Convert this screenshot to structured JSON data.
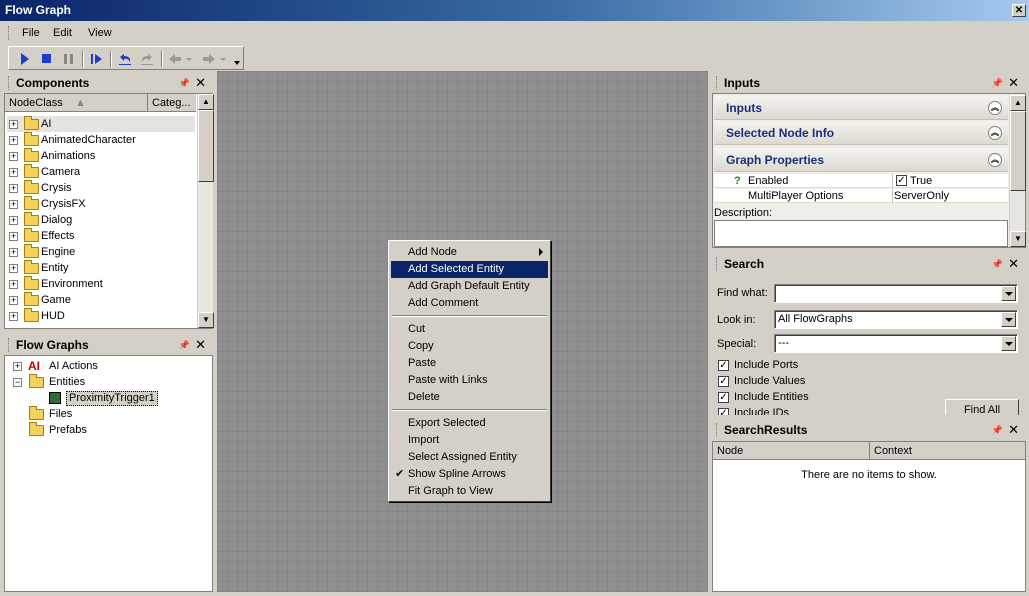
{
  "window": {
    "title": "Flow Graph",
    "close_glyph": "✕"
  },
  "menu": {
    "file": "File",
    "edit": "Edit",
    "view": "View"
  },
  "components": {
    "title": "Components",
    "pin": "📌",
    "close": "✕",
    "col_nodeclass": "NodeClass",
    "col_category": "Categ...",
    "items": [
      "AI",
      "AnimatedCharacter",
      "Animations",
      "Camera",
      "Crysis",
      "CrysisFX",
      "Dialog",
      "Effects",
      "Engine",
      "Entity",
      "Environment",
      "Game",
      "HUD"
    ]
  },
  "flowgraphs": {
    "title": "Flow Graphs",
    "ai_badge": "AI",
    "ai_actions": "AI Actions",
    "entities": "Entities",
    "proximity": "ProximityTrigger1",
    "files": "Files",
    "prefabs": "Prefabs"
  },
  "context_menu": {
    "add_node": "Add Node",
    "add_selected_entity": "Add Selected Entity",
    "add_graph_default_entity": "Add Graph Default Entity",
    "add_comment": "Add Comment",
    "cut": "Cut",
    "copy": "Copy",
    "paste": "Paste",
    "paste_with_links": "Paste with Links",
    "delete": "Delete",
    "export_selected": "Export Selected",
    "import": "Import",
    "select_assigned_entity": "Select Assigned Entity",
    "show_spline_arrows": "Show Spline Arrows",
    "fit_graph": "Fit Graph to View",
    "check": "✔"
  },
  "inputs_panel": {
    "title": "Inputs",
    "sec_inputs": "Inputs",
    "sec_selected_node": "Selected Node Info",
    "sec_graph_props": "Graph Properties",
    "chevron": "︽",
    "enabled_label": "Enabled",
    "enabled_value": "True",
    "help_mark": "?",
    "multiplayer_label": "MultiPlayer Options",
    "multiplayer_value": "ServerOnly",
    "description_label": "Description:"
  },
  "search": {
    "title": "Search",
    "find_what_label": "Find what:",
    "find_what_value": "",
    "look_in_label": "Look in:",
    "look_in_value": "All FlowGraphs",
    "special_label": "Special:",
    "special_value": "---",
    "include_ports": "Include Ports",
    "include_values": "Include Values",
    "include_entities": "Include Entities",
    "include_ids": "Include IDs",
    "find_all": "Find All",
    "checkmark": "✓"
  },
  "results": {
    "title": "SearchResults",
    "col_node": "Node",
    "col_context": "Context",
    "empty": "There are no items to show."
  }
}
